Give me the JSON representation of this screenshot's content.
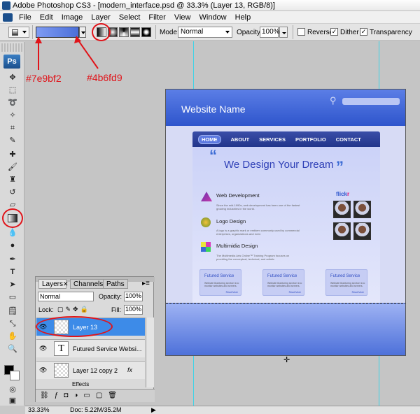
{
  "window": {
    "title": "Adobe Photoshop CS3 - [modern_interface.psd @ 33.3% (Layer 13, RGB/8)]"
  },
  "menu": [
    "File",
    "Edit",
    "Image",
    "Layer",
    "Select",
    "Filter",
    "View",
    "Window",
    "Help"
  ],
  "options_bar": {
    "mode_label": "Mode:",
    "mode_value": "Normal",
    "opacity_label": "Opacity:",
    "opacity_value": "100%",
    "reverse_label": "Reverse",
    "dither_label": "Dither",
    "transparency_label": "Transparency",
    "reverse_checked": false,
    "dither_checked": true,
    "transparency_checked": true
  },
  "gradient": {
    "start_color": "#7e9bf2",
    "end_color": "#4b6fd9"
  },
  "annotations": {
    "start_color_label": "#7e9bf2",
    "end_color_label": "#4b6fd9"
  },
  "toolbox": {
    "badge": "Ps"
  },
  "document": {
    "site_name": "Website Name",
    "nav": [
      "HOME",
      "ABOUT",
      "SERVICES",
      "PORTFOLIO",
      "CONTACT"
    ],
    "open_quote": "“",
    "headline": "We Design Your Dream",
    "close_quote": "”",
    "services": [
      {
        "title": "Web Development",
        "desc": "Since the mid-1990s, web development has been one of the fastest growing industries in the world."
      },
      {
        "title": "Logo Design",
        "desc": "A logo is a graphic mark or emblem commonly used by commercial enterprises, organizations and even"
      },
      {
        "title": "Multimidia Design",
        "desc": "The Multimedia Arts Online™ Training Program focuses on providing the conceptual, technical, and artistic"
      }
    ],
    "flickr": {
      "prefix": "flick",
      "suffix": "r"
    },
    "futured_cards": [
      {
        "title": "Futured Service",
        "desc": "Website Monitoring service is to monitor websites and servers.",
        "more": "Read More"
      },
      {
        "title": "Futured Service",
        "desc": "Website Monitoring service is to monitor websites and servers.",
        "more": "Read More"
      },
      {
        "title": "Futured Service",
        "desc": "Website Monitoring service is to monitor websites and servers.",
        "more": "Read More"
      }
    ]
  },
  "layers_panel": {
    "tabs": [
      "Layers",
      "Channels",
      "Paths"
    ],
    "blend_mode": "Normal",
    "opacity_label": "Opacity:",
    "opacity": "100%",
    "lock_label": "Lock:",
    "fill_label": "Fill:",
    "fill": "100%",
    "layers": [
      {
        "name": "Layer 13",
        "selected": true
      },
      {
        "name": "Futured Service  Websi...",
        "type": "text"
      },
      {
        "name": "Layer 12 copy 2",
        "fx": "fx"
      }
    ],
    "effects_label": "Effects"
  },
  "status": {
    "zoom": "33.33%",
    "doc": "Doc: 5.22M/35.2M"
  }
}
